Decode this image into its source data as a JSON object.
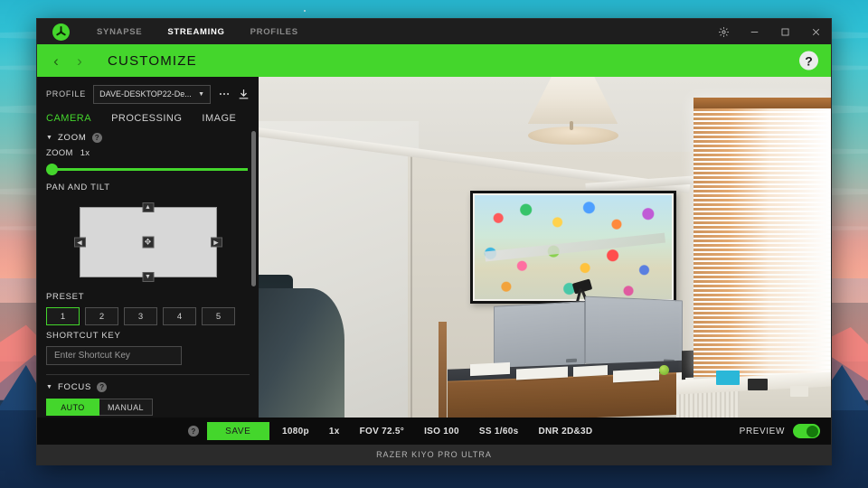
{
  "titlebar": {
    "logo_icon": "razer-logo-icon",
    "tabs": [
      {
        "label": "SYNAPSE",
        "active": false
      },
      {
        "label": "STREAMING",
        "active": true
      },
      {
        "label": "PROFILES",
        "active": false
      }
    ],
    "controls": {
      "settings_icon": "gear-icon",
      "minimize_icon": "minimize-icon",
      "maximize_icon": "maximize-icon",
      "close_icon": "close-icon"
    }
  },
  "header": {
    "back_arrow": "‹",
    "forward_arrow": "›",
    "title": "CUSTOMIZE",
    "help_label": "?",
    "accent_color": "#44d62c"
  },
  "sidebar": {
    "profile_label": "PROFILE",
    "profile_value": "DAVE-DESKTOP22-De...",
    "profile_more_icon": "ellipsis-icon",
    "profile_download_icon": "download-icon",
    "subtabs": [
      {
        "label": "CAMERA",
        "active": true
      },
      {
        "label": "PROCESSING",
        "active": false
      },
      {
        "label": "IMAGE",
        "active": false
      }
    ],
    "zoom_section": {
      "title": "ZOOM",
      "help": "?",
      "field_label": "ZOOM",
      "field_value": "1x",
      "slider_percent": 0
    },
    "pan_tilt": {
      "label": "PAN AND TILT",
      "up_icon": "arrow-up-icon",
      "down_icon": "arrow-down-icon",
      "left_icon": "arrow-left-icon",
      "right_icon": "arrow-right-icon",
      "center_icon": "move-center-icon"
    },
    "preset": {
      "label": "PRESET",
      "buttons": [
        "1",
        "2",
        "3",
        "4",
        "5"
      ],
      "active_index": 0
    },
    "shortcut": {
      "label": "SHORTCUT KEY",
      "placeholder": "Enter Shortcut Key",
      "value": ""
    },
    "focus_section": {
      "title": "FOCUS",
      "help": "?",
      "modes": [
        {
          "label": "AUTO",
          "active": true
        },
        {
          "label": "MANUAL",
          "active": false
        }
      ]
    }
  },
  "bottom_bar": {
    "help_label": "?",
    "save_label": "SAVE",
    "stats": [
      "1080p",
      "1x",
      "FOV 72.5°",
      "ISO 100",
      "SS 1/60s",
      "DNR 2D&3D"
    ],
    "preview_label": "PREVIEW",
    "preview_enabled": true
  },
  "footer": {
    "device_name": "RAZER KIYO PRO ULTRA"
  }
}
